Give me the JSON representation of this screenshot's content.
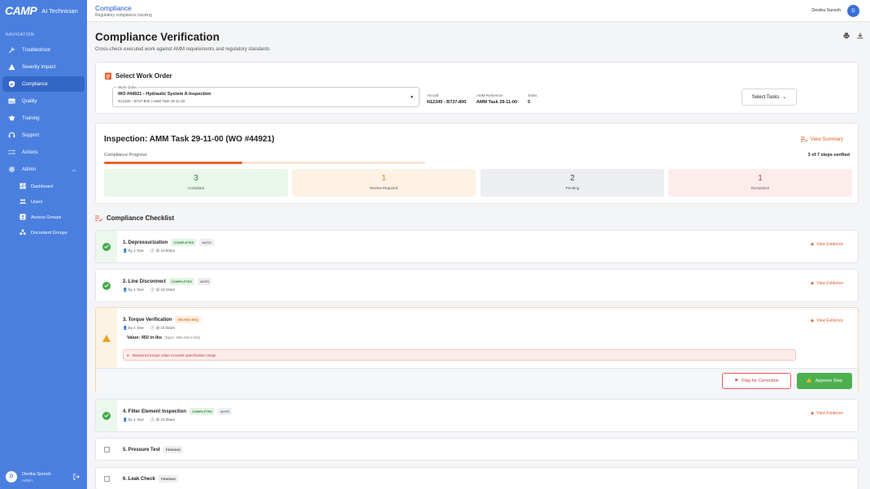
{
  "app": {
    "logo": "CAMP",
    "subtitle": "AI Technician"
  },
  "sidebar": {
    "heading": "NAVIGATION",
    "items": [
      {
        "label": "Troubleshoot",
        "icon": "wrench-icon"
      },
      {
        "label": "Severity Impact",
        "icon": "warning-icon"
      },
      {
        "label": "Compliance",
        "icon": "shield-check-icon",
        "active": true
      },
      {
        "label": "Quality",
        "icon": "hq-icon"
      },
      {
        "label": "Training",
        "icon": "graduation-cap-icon"
      },
      {
        "label": "Support",
        "icon": "headset-icon"
      },
      {
        "label": "Actions",
        "icon": "checklist-icon"
      },
      {
        "label": "Admin",
        "icon": "gear-icon",
        "expanded": true
      }
    ],
    "admin_items": [
      {
        "label": "Dashboard"
      },
      {
        "label": "Users"
      },
      {
        "label": "Access Groups"
      },
      {
        "label": "Document Groups"
      }
    ],
    "user": {
      "initial": "D",
      "name": "Devika Suresh",
      "role": "Admin"
    }
  },
  "topbar": {
    "title": "Compliance",
    "subtitle": "Regulatory compliance tracking",
    "user_name": "Devika Suresh",
    "user_initial": "D"
  },
  "page": {
    "title": "Compliance Verification",
    "subtitle": "Cross-check executed work against AMM requirements and regulatory standards"
  },
  "work_order": {
    "section_title": "Select Work Order",
    "field_label": "Work Order",
    "value": "WO #44921 - Hydraulic System A Inspection",
    "meta": "N12345 - B737-800 | AMM Task 29-11-00",
    "aircraft_label": "Aircraft",
    "aircraft": "N12345 - B737-800",
    "amm_label": "AMM Reference",
    "amm": "AMM Task 29-11-00",
    "tasks_label": "Tasks",
    "tasks": "5",
    "select_tasks": "Select Tasks"
  },
  "inspection": {
    "title": "Inspection: AMM Task 29-11-00 (WO #44921)",
    "view_summary": "View Summary",
    "progress_label": "Compliance Progress",
    "progress_text": "3 of 7 steps verified",
    "progress_fraction": 0.43,
    "stats": [
      {
        "num": "3",
        "label": "Compliant",
        "bg": "#e9f6ea",
        "color": "#2e8b3a"
      },
      {
        "num": "1",
        "label": "Review Required",
        "bg": "#fdf2e3",
        "color": "#e07b1c"
      },
      {
        "num": "2",
        "label": "Pending",
        "bg": "#eceef1",
        "color": "#444444"
      },
      {
        "num": "1",
        "label": "Exceptions",
        "bg": "#fdecec",
        "color": "#c83a3a"
      }
    ]
  },
  "checklist": {
    "heading": "Compliance Checklist",
    "view_evidence": "View Evidence",
    "steps": [
      {
        "title": "1. Depressurization",
        "status": "COMPLETED",
        "tag": "AUTO",
        "by": "by J. Doe",
        "time": "@ 10:00am"
      },
      {
        "title": "2. Line Disconnect",
        "status": "COMPLETED",
        "tag": "AUTO",
        "by": "by J. Doe",
        "time": "@ 10:15am"
      },
      {
        "title": "3. Torque Verification",
        "status": "REVIEW REQ",
        "by": "by J. Doe",
        "time": "@ 10:32am",
        "value": "Value: 450 in-lbs",
        "spec": "(Spec: 400-440 in-lbs)",
        "error": "Measured torque value exceeds specification range",
        "flag": "Flag for Correction",
        "approve": "Approve Step"
      },
      {
        "title": "4. Filter Element Inspection",
        "status": "COMPLETED",
        "tag": "AUTO",
        "by": "by J. Doe",
        "time": "@ 10:45am"
      },
      {
        "title": "5. Pressure Test",
        "status": "PENDING"
      },
      {
        "title": "6. Leak Check",
        "status": "PENDING"
      }
    ]
  }
}
